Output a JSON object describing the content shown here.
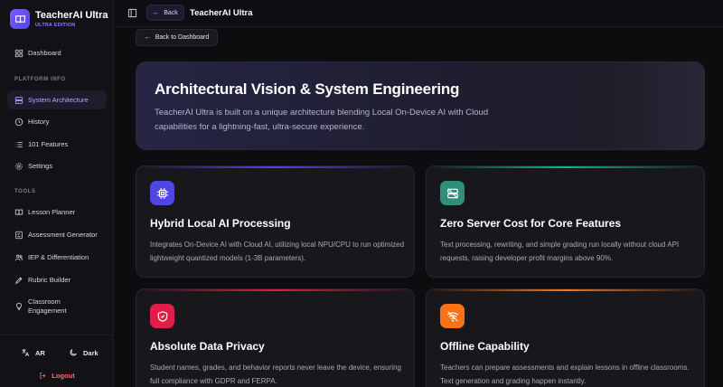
{
  "app": {
    "title": "TeacherAI Ultra",
    "edition": "ULTRA EDITION"
  },
  "sidebar": {
    "dashboard": "Dashboard",
    "section_platform": "PLATFORM INFO",
    "platform_items": [
      {
        "label": "System Architecture",
        "icon": "server-icon",
        "active": true
      },
      {
        "label": "History",
        "icon": "clock-icon",
        "active": false
      },
      {
        "label": "101 Features",
        "icon": "list-icon",
        "active": false
      },
      {
        "label": "Settings",
        "icon": "gear-icon",
        "active": false
      }
    ],
    "section_tools": "TOOLS",
    "tool_items": [
      {
        "label": "Lesson Planner",
        "icon": "book-icon"
      },
      {
        "label": "Assessment Generator",
        "icon": "checklist-icon"
      },
      {
        "label": "IEP & Differentiation",
        "icon": "users-icon"
      },
      {
        "label": "Rubric Builder",
        "icon": "rubric-icon"
      },
      {
        "label": "Classroom Engagement",
        "icon": "lightbulb-icon"
      }
    ],
    "language_toggle": "AR",
    "theme_toggle": "Dark",
    "logout": "Logout"
  },
  "topbar": {
    "back_label": "Back",
    "title": "TeacherAI Ultra"
  },
  "main": {
    "back_to_dashboard": "Back to Dashboard",
    "hero": {
      "title": "Architectural Vision & System Engineering",
      "description": "TeacherAI Ultra is built on a unique architecture blending Local On-Device AI with Cloud capabilities for a lightning-fast, ultra-secure experience."
    },
    "cards": [
      {
        "title": "Hybrid Local AI Processing",
        "description": "Integrates On-Device AI with Cloud AI, utilizing local NPU/CPU to run optimized lightweight quantized models (1-3B parameters).",
        "icon": "cpu-icon",
        "color": "#4f46e5"
      },
      {
        "title": "Zero Server Cost for Core Features",
        "description": "Text processing, rewriting, and simple grading run locally without cloud API requests, raising developer profit margins above 90%.",
        "icon": "server-off-icon",
        "color": "#10b981"
      },
      {
        "title": "Absolute Data Privacy",
        "description": "Student names, grades, and behavior reports never leave the device, ensuring full compliance with GDPR and FERPA.",
        "icon": "shield-icon",
        "color": "#e11d48"
      },
      {
        "title": "Offline Capability",
        "description": "Teachers can prepare assessments and explain lessons in offline classrooms. Text generation and grading happen instantly.",
        "icon": "wifi-off-icon",
        "color": "#f97316"
      }
    ]
  },
  "colors": {
    "accent": "#7c5cff",
    "background": "#0d0d10",
    "sidebar": "#121216",
    "logout": "#ff6b6b"
  }
}
